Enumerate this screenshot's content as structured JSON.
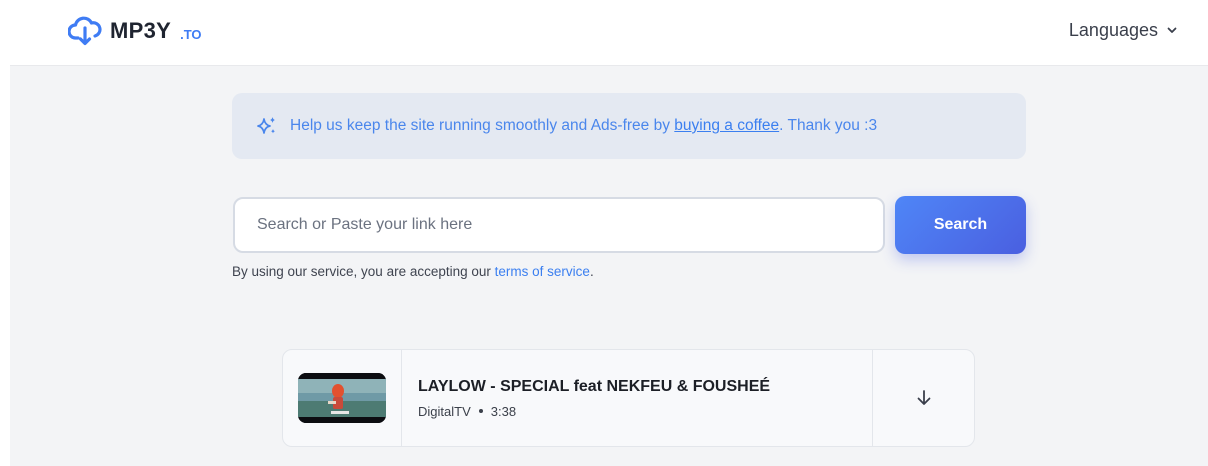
{
  "header": {
    "logo_text": "MP3Y",
    "logo_tld": ".TO",
    "languages_label": "Languages"
  },
  "notice": {
    "text_before": "Help us keep the site running smoothly and Ads-free by",
    "link_text": "buying a coffee",
    "text_after": ". Thank you :3"
  },
  "search": {
    "placeholder": "Search or Paste your link here",
    "button_label": "Search"
  },
  "terms": {
    "text": "By using our service, you are accepting our",
    "link_text": "terms of service",
    "suffix": "."
  },
  "results": [
    {
      "title": "LAYLOW - SPECIAL feat NEKFEU & FOUSHEÉ",
      "channel": "DigitalTV",
      "duration": "3:38"
    }
  ],
  "colors": {
    "accent": "#3b7ff0",
    "button_gradient_start": "#4f86f7",
    "button_gradient_end": "#4a5fe0",
    "notice_bg": "#e4e9f2",
    "page_bg": "#f3f4f6"
  },
  "icons": {
    "logo": "cloud-download-icon",
    "languages": "chevron-down-icon",
    "notice": "sparkles-icon",
    "download": "arrow-down-icon"
  }
}
